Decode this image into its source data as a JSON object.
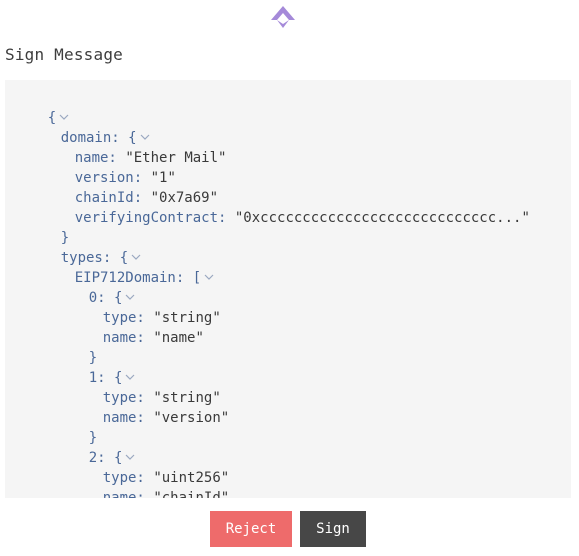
{
  "header": {
    "logo": "brand-logo-icon",
    "title": "Sign Message"
  },
  "colors": {
    "brand": "#a58ad9",
    "panel_bg": "#f5f5f5",
    "key": "#4a6898",
    "reject": "#ee6b6b",
    "sign": "#474747"
  },
  "json_view": {
    "root_open": "{",
    "domain_key": "domain:",
    "domain_open": "{",
    "name_key": "name:",
    "name_value": "\"Ether Mail\"",
    "version_key": "version:",
    "version_value": "\"1\"",
    "chainId_key": "chainId:",
    "chainId_value": "\"0x7a69\"",
    "verifyingContract_key": "verifyingContract:",
    "verifyingContract_value": "\"0xcccccccccccccccccccccccccccc...\"",
    "domain_close": "}",
    "types_key": "types:",
    "types_open": "{",
    "eip712_key": "EIP712Domain:",
    "eip712_open": "[",
    "item0_key": "0:",
    "item0_open": "{",
    "item0_type_key": "type:",
    "item0_type_value": "\"string\"",
    "item0_name_key": "name:",
    "item0_name_value": "\"name\"",
    "item0_close": "}",
    "item1_key": "1:",
    "item1_open": "{",
    "item1_type_key": "type:",
    "item1_type_value": "\"string\"",
    "item1_name_key": "name:",
    "item1_name_value": "\"version\"",
    "item1_close": "}",
    "item2_key": "2:",
    "item2_open": "{",
    "item2_type_key": "type:",
    "item2_type_value": "\"uint256\"",
    "item2_name_key": "name:",
    "item2_name_value": "\"chainId\"",
    "item2_close": "}"
  },
  "actions": {
    "reject_label": "Reject",
    "sign_label": "Sign"
  }
}
